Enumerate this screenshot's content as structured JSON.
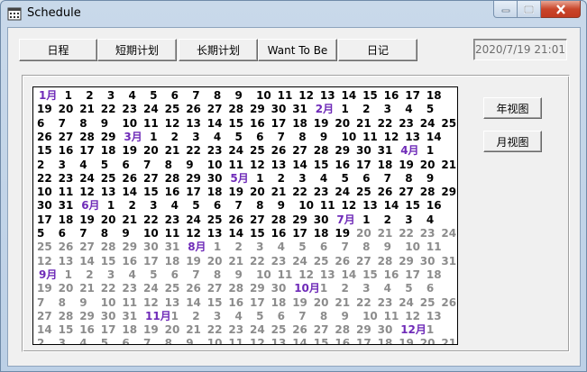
{
  "window": {
    "title": "Schedule"
  },
  "nav": {
    "tabs": [
      "日程",
      "短期计划",
      "长期计划",
      "Want To Be",
      "日记"
    ]
  },
  "datetime": "2020/7/19 21:01",
  "side_buttons": {
    "year_view": "年视图",
    "month_view": "月视图"
  },
  "colors": {
    "current_year_text": "#000000",
    "next_year_text": "#8c8c8c",
    "month_label": "#6f2bb8"
  },
  "calendar": {
    "months_labels": [
      "1月",
      "2月",
      "3月",
      "4月",
      "5月",
      "6月",
      "7月",
      "8月",
      "9月",
      "10月",
      "11月",
      "12月"
    ],
    "rows": [
      [
        {
          "t": "1月",
          "k": "m"
        },
        "1",
        "2",
        "3",
        "4",
        "5",
        "6",
        "7",
        "8",
        "9",
        "10",
        "11",
        "12",
        "13",
        "14",
        "15",
        "16",
        "17",
        "18"
      ],
      [
        "19",
        "20",
        "21",
        "22",
        "23",
        "24",
        "25",
        "26",
        "27",
        "28",
        "29",
        "30",
        "31",
        {
          "t": "2月",
          "k": "m"
        },
        "1",
        "2",
        "3",
        "4",
        "5"
      ],
      [
        "6",
        "7",
        "8",
        "9",
        "10",
        "11",
        "12",
        "13",
        "14",
        "15",
        "16",
        "17",
        "18",
        "19",
        "20",
        "21",
        "22",
        "23",
        "24",
        "25"
      ],
      [
        "26",
        "27",
        "28",
        "29",
        {
          "t": "3月",
          "k": "m"
        },
        "1",
        "2",
        "3",
        "4",
        "5",
        "6",
        "7",
        "8",
        "9",
        "10",
        "11",
        "12",
        "13",
        "14"
      ],
      [
        "15",
        "16",
        "17",
        "18",
        "19",
        "20",
        "21",
        "22",
        "23",
        "24",
        "25",
        "26",
        "27",
        "28",
        "29",
        "30",
        "31",
        {
          "t": "4月",
          "k": "m"
        },
        "1"
      ],
      [
        "2",
        "3",
        "4",
        "5",
        "6",
        "7",
        "8",
        "9",
        "10",
        "11",
        "12",
        "13",
        "14",
        "15",
        "16",
        "17",
        "18",
        "19",
        "20",
        "21"
      ],
      [
        "22",
        "23",
        "24",
        "25",
        "26",
        "27",
        "28",
        "29",
        "30",
        {
          "t": "5月",
          "k": "m"
        },
        "1",
        "2",
        "3",
        "4",
        "5",
        "6",
        "7",
        "8",
        "9"
      ],
      [
        "10",
        "11",
        "12",
        "13",
        "14",
        "15",
        "16",
        "17",
        "18",
        "19",
        "20",
        "21",
        "22",
        "23",
        "24",
        "25",
        "26",
        "27",
        "28",
        "29"
      ],
      [
        "30",
        "31",
        {
          "t": "6月",
          "k": "m"
        },
        "1",
        "2",
        "3",
        "4",
        "5",
        "6",
        "7",
        "8",
        "9",
        "10",
        "11",
        "12",
        "13",
        "14",
        "15",
        "16"
      ],
      [
        "17",
        "18",
        "19",
        "20",
        "21",
        "22",
        "23",
        "24",
        "25",
        "26",
        "27",
        "28",
        "29",
        "30",
        {
          "t": "7月",
          "k": "m"
        },
        "1",
        "2",
        "3",
        "4"
      ],
      [
        "5",
        "6",
        "7",
        "8",
        "9",
        "10",
        "11",
        "12",
        "13",
        "14",
        "15",
        "16",
        "17",
        "18",
        "19",
        {
          "t": "20",
          "k": "n"
        },
        {
          "t": "21",
          "k": "n"
        },
        {
          "t": "22",
          "k": "n"
        },
        {
          "t": "23",
          "k": "n"
        },
        {
          "t": "24",
          "k": "n"
        }
      ],
      [
        {
          "t": "25",
          "k": "n"
        },
        {
          "t": "26",
          "k": "n"
        },
        {
          "t": "27",
          "k": "n"
        },
        {
          "t": "28",
          "k": "n"
        },
        {
          "t": "29",
          "k": "n"
        },
        {
          "t": "30",
          "k": "n"
        },
        {
          "t": "31",
          "k": "n"
        },
        {
          "t": "8月",
          "k": "m"
        },
        {
          "t": "1",
          "k": "n"
        },
        {
          "t": "2",
          "k": "n"
        },
        {
          "t": "3",
          "k": "n"
        },
        {
          "t": "4",
          "k": "n"
        },
        {
          "t": "5",
          "k": "n"
        },
        {
          "t": "6",
          "k": "n"
        },
        {
          "t": "7",
          "k": "n"
        },
        {
          "t": "8",
          "k": "n"
        },
        {
          "t": "9",
          "k": "n"
        },
        {
          "t": "10",
          "k": "n"
        },
        {
          "t": "11",
          "k": "n"
        }
      ],
      [
        {
          "t": "12",
          "k": "n"
        },
        {
          "t": "13",
          "k": "n"
        },
        {
          "t": "14",
          "k": "n"
        },
        {
          "t": "15",
          "k": "n"
        },
        {
          "t": "16",
          "k": "n"
        },
        {
          "t": "17",
          "k": "n"
        },
        {
          "t": "18",
          "k": "n"
        },
        {
          "t": "19",
          "k": "n"
        },
        {
          "t": "20",
          "k": "n"
        },
        {
          "t": "21",
          "k": "n"
        },
        {
          "t": "22",
          "k": "n"
        },
        {
          "t": "23",
          "k": "n"
        },
        {
          "t": "24",
          "k": "n"
        },
        {
          "t": "25",
          "k": "n"
        },
        {
          "t": "26",
          "k": "n"
        },
        {
          "t": "27",
          "k": "n"
        },
        {
          "t": "28",
          "k": "n"
        },
        {
          "t": "29",
          "k": "n"
        },
        {
          "t": "30",
          "k": "n"
        },
        {
          "t": "31",
          "k": "n"
        }
      ],
      [
        {
          "t": "9月",
          "k": "m"
        },
        {
          "t": "1",
          "k": "n"
        },
        {
          "t": "2",
          "k": "n"
        },
        {
          "t": "3",
          "k": "n"
        },
        {
          "t": "4",
          "k": "n"
        },
        {
          "t": "5",
          "k": "n"
        },
        {
          "t": "6",
          "k": "n"
        },
        {
          "t": "7",
          "k": "n"
        },
        {
          "t": "8",
          "k": "n"
        },
        {
          "t": "9",
          "k": "n"
        },
        {
          "t": "10",
          "k": "n"
        },
        {
          "t": "11",
          "k": "n"
        },
        {
          "t": "12",
          "k": "n"
        },
        {
          "t": "13",
          "k": "n"
        },
        {
          "t": "14",
          "k": "n"
        },
        {
          "t": "15",
          "k": "n"
        },
        {
          "t": "16",
          "k": "n"
        },
        {
          "t": "17",
          "k": "n"
        },
        {
          "t": "18",
          "k": "n"
        }
      ],
      [
        {
          "t": "19",
          "k": "n"
        },
        {
          "t": "20",
          "k": "n"
        },
        {
          "t": "21",
          "k": "n"
        },
        {
          "t": "22",
          "k": "n"
        },
        {
          "t": "23",
          "k": "n"
        },
        {
          "t": "24",
          "k": "n"
        },
        {
          "t": "25",
          "k": "n"
        },
        {
          "t": "26",
          "k": "n"
        },
        {
          "t": "27",
          "k": "n"
        },
        {
          "t": "28",
          "k": "n"
        },
        {
          "t": "29",
          "k": "n"
        },
        {
          "t": "30",
          "k": "n"
        },
        {
          "t": "10月",
          "k": "m"
        },
        {
          "t": "1",
          "k": "n"
        },
        {
          "t": "2",
          "k": "n"
        },
        {
          "t": "3",
          "k": "n"
        },
        {
          "t": "4",
          "k": "n"
        },
        {
          "t": "5",
          "k": "n"
        },
        {
          "t": "6",
          "k": "n"
        }
      ],
      [
        {
          "t": "7",
          "k": "n"
        },
        {
          "t": "8",
          "k": "n"
        },
        {
          "t": "9",
          "k": "n"
        },
        {
          "t": "10",
          "k": "n"
        },
        {
          "t": "11",
          "k": "n"
        },
        {
          "t": "12",
          "k": "n"
        },
        {
          "t": "13",
          "k": "n"
        },
        {
          "t": "14",
          "k": "n"
        },
        {
          "t": "15",
          "k": "n"
        },
        {
          "t": "16",
          "k": "n"
        },
        {
          "t": "17",
          "k": "n"
        },
        {
          "t": "18",
          "k": "n"
        },
        {
          "t": "19",
          "k": "n"
        },
        {
          "t": "20",
          "k": "n"
        },
        {
          "t": "21",
          "k": "n"
        },
        {
          "t": "22",
          "k": "n"
        },
        {
          "t": "23",
          "k": "n"
        },
        {
          "t": "24",
          "k": "n"
        },
        {
          "t": "25",
          "k": "n"
        },
        {
          "t": "26",
          "k": "n"
        }
      ],
      [
        {
          "t": "27",
          "k": "n"
        },
        {
          "t": "28",
          "k": "n"
        },
        {
          "t": "29",
          "k": "n"
        },
        {
          "t": "30",
          "k": "n"
        },
        {
          "t": "31",
          "k": "n"
        },
        {
          "t": "11月",
          "k": "m"
        },
        {
          "t": "1",
          "k": "n"
        },
        {
          "t": "2",
          "k": "n"
        },
        {
          "t": "3",
          "k": "n"
        },
        {
          "t": "4",
          "k": "n"
        },
        {
          "t": "5",
          "k": "n"
        },
        {
          "t": "6",
          "k": "n"
        },
        {
          "t": "7",
          "k": "n"
        },
        {
          "t": "8",
          "k": "n"
        },
        {
          "t": "9",
          "k": "n"
        },
        {
          "t": "10",
          "k": "n"
        },
        {
          "t": "11",
          "k": "n"
        },
        {
          "t": "12",
          "k": "n"
        },
        {
          "t": "13",
          "k": "n"
        }
      ],
      [
        {
          "t": "14",
          "k": "n"
        },
        {
          "t": "15",
          "k": "n"
        },
        {
          "t": "16",
          "k": "n"
        },
        {
          "t": "17",
          "k": "n"
        },
        {
          "t": "18",
          "k": "n"
        },
        {
          "t": "19",
          "k": "n"
        },
        {
          "t": "20",
          "k": "n"
        },
        {
          "t": "21",
          "k": "n"
        },
        {
          "t": "22",
          "k": "n"
        },
        {
          "t": "23",
          "k": "n"
        },
        {
          "t": "24",
          "k": "n"
        },
        {
          "t": "25",
          "k": "n"
        },
        {
          "t": "26",
          "k": "n"
        },
        {
          "t": "27",
          "k": "n"
        },
        {
          "t": "28",
          "k": "n"
        },
        {
          "t": "29",
          "k": "n"
        },
        {
          "t": "30",
          "k": "n"
        },
        {
          "t": "12月",
          "k": "m"
        },
        {
          "t": "1",
          "k": "n"
        }
      ],
      [
        {
          "t": "2",
          "k": "n"
        },
        {
          "t": "3",
          "k": "n"
        },
        {
          "t": "4",
          "k": "n"
        },
        {
          "t": "5",
          "k": "n"
        },
        {
          "t": "6",
          "k": "n"
        },
        {
          "t": "7",
          "k": "n"
        },
        {
          "t": "8",
          "k": "n"
        },
        {
          "t": "9",
          "k": "n"
        },
        {
          "t": "10",
          "k": "n"
        },
        {
          "t": "11",
          "k": "n"
        },
        {
          "t": "12",
          "k": "n"
        },
        {
          "t": "13",
          "k": "n"
        },
        {
          "t": "14",
          "k": "n"
        },
        {
          "t": "15",
          "k": "n"
        },
        {
          "t": "16",
          "k": "n"
        },
        {
          "t": "17",
          "k": "n"
        },
        {
          "t": "18",
          "k": "n"
        },
        {
          "t": "19",
          "k": "n"
        },
        {
          "t": "20",
          "k": "n"
        },
        {
          "t": "21",
          "k": "n"
        }
      ],
      [
        {
          "t": "22",
          "k": "n"
        },
        {
          "t": "23",
          "k": "n"
        },
        {
          "t": "24",
          "k": "n"
        },
        {
          "t": "25",
          "k": "n"
        },
        {
          "t": "26",
          "k": "n"
        },
        {
          "t": "27",
          "k": "n"
        },
        {
          "t": "28",
          "k": "n"
        },
        {
          "t": "29",
          "k": "n"
        },
        {
          "t": "30",
          "k": "n"
        },
        {
          "t": "31",
          "k": "n"
        }
      ]
    ]
  }
}
